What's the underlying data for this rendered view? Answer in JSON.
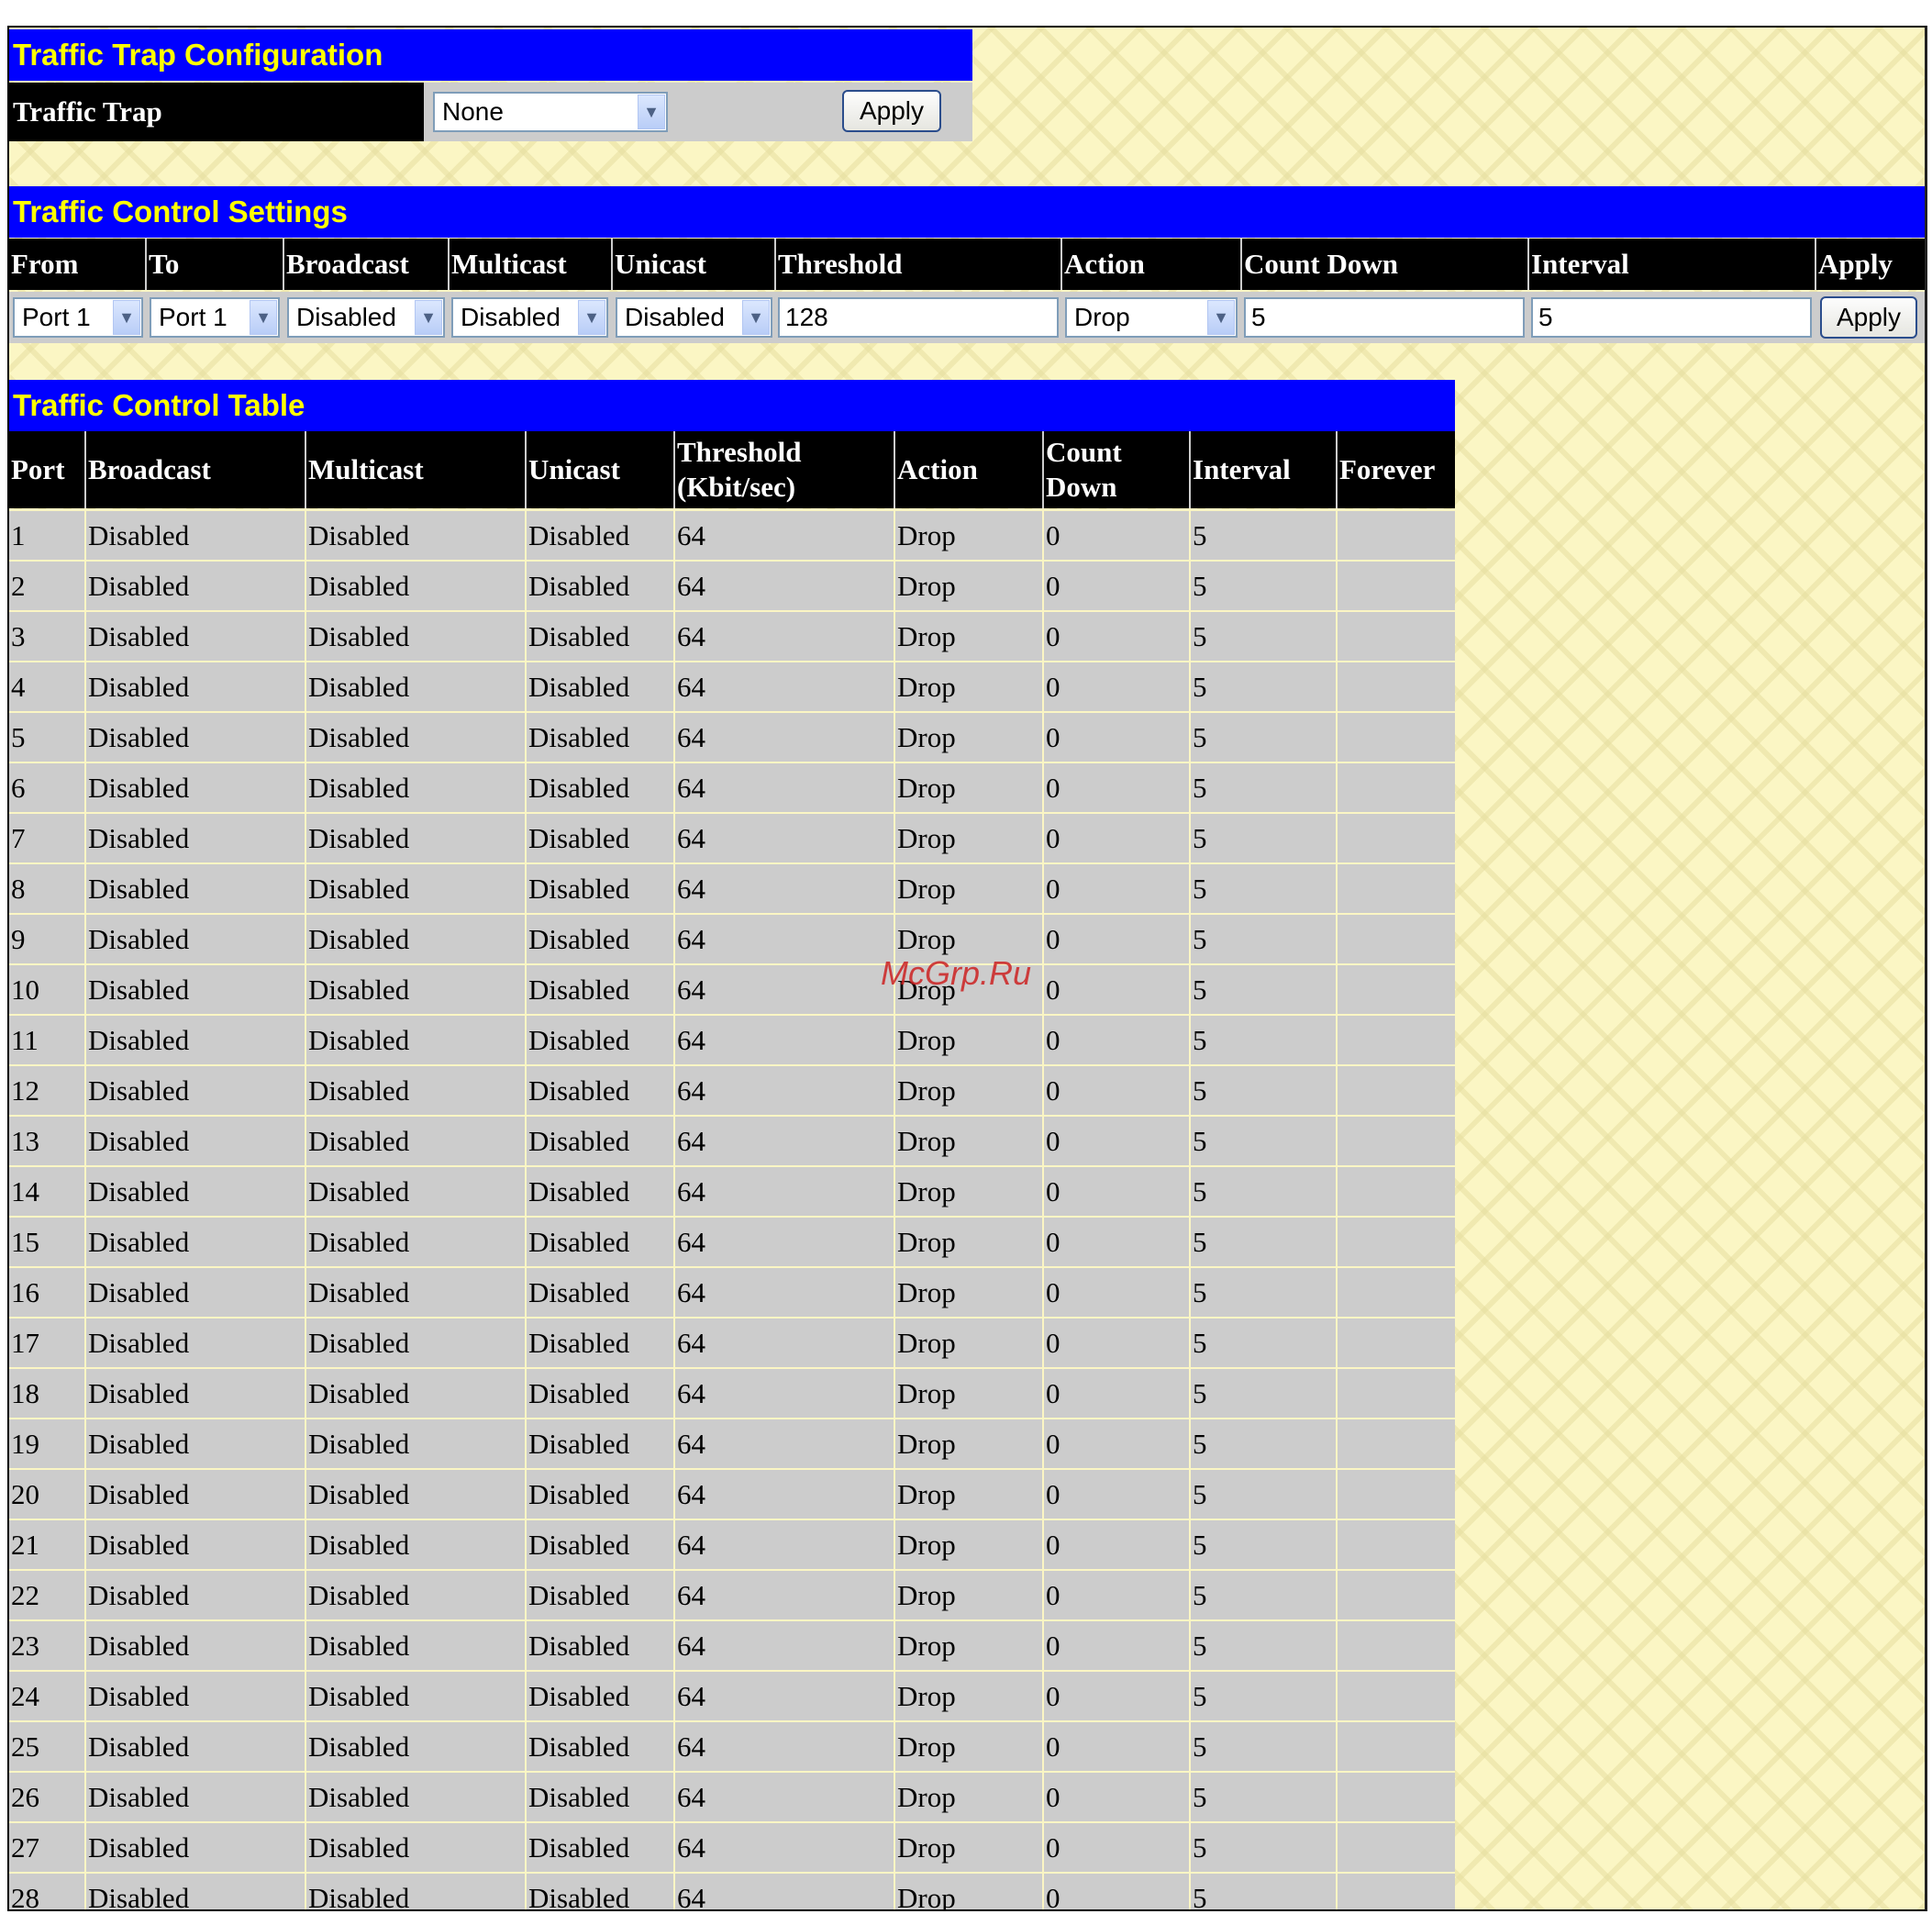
{
  "trap_config": {
    "title": "Traffic Trap Configuration",
    "label": "Traffic Trap",
    "selected": "None",
    "apply_label": "Apply"
  },
  "settings": {
    "title": "Traffic Control Settings",
    "headers": [
      "From",
      "To",
      "Broadcast",
      "Multicast",
      "Unicast",
      "Threshold",
      "Action",
      "Count Down",
      "Interval",
      "Apply"
    ],
    "from": "Port 1",
    "to": "Port 1",
    "broadcast": "Disabled",
    "multicast": "Disabled",
    "unicast": "Disabled",
    "threshold": "128",
    "action": "Drop",
    "count_down": "5",
    "interval": "5",
    "apply_label": "Apply"
  },
  "table": {
    "title": "Traffic Control Table",
    "headers": [
      "Port",
      "Broadcast",
      "Multicast",
      "Unicast",
      "Threshold (Kbit/sec)",
      "Action",
      "Count Down",
      "Interval",
      "Forever"
    ],
    "rows": [
      [
        "1",
        "Disabled",
        "Disabled",
        "Disabled",
        "64",
        "Drop",
        "0",
        "5",
        ""
      ],
      [
        "2",
        "Disabled",
        "Disabled",
        "Disabled",
        "64",
        "Drop",
        "0",
        "5",
        ""
      ],
      [
        "3",
        "Disabled",
        "Disabled",
        "Disabled",
        "64",
        "Drop",
        "0",
        "5",
        ""
      ],
      [
        "4",
        "Disabled",
        "Disabled",
        "Disabled",
        "64",
        "Drop",
        "0",
        "5",
        ""
      ],
      [
        "5",
        "Disabled",
        "Disabled",
        "Disabled",
        "64",
        "Drop",
        "0",
        "5",
        ""
      ],
      [
        "6",
        "Disabled",
        "Disabled",
        "Disabled",
        "64",
        "Drop",
        "0",
        "5",
        ""
      ],
      [
        "7",
        "Disabled",
        "Disabled",
        "Disabled",
        "64",
        "Drop",
        "0",
        "5",
        ""
      ],
      [
        "8",
        "Disabled",
        "Disabled",
        "Disabled",
        "64",
        "Drop",
        "0",
        "5",
        ""
      ],
      [
        "9",
        "Disabled",
        "Disabled",
        "Disabled",
        "64",
        "Drop",
        "0",
        "5",
        ""
      ],
      [
        "10",
        "Disabled",
        "Disabled",
        "Disabled",
        "64",
        "Drop",
        "0",
        "5",
        ""
      ],
      [
        "11",
        "Disabled",
        "Disabled",
        "Disabled",
        "64",
        "Drop",
        "0",
        "5",
        ""
      ],
      [
        "12",
        "Disabled",
        "Disabled",
        "Disabled",
        "64",
        "Drop",
        "0",
        "5",
        ""
      ],
      [
        "13",
        "Disabled",
        "Disabled",
        "Disabled",
        "64",
        "Drop",
        "0",
        "5",
        ""
      ],
      [
        "14",
        "Disabled",
        "Disabled",
        "Disabled",
        "64",
        "Drop",
        "0",
        "5",
        ""
      ],
      [
        "15",
        "Disabled",
        "Disabled",
        "Disabled",
        "64",
        "Drop",
        "0",
        "5",
        ""
      ],
      [
        "16",
        "Disabled",
        "Disabled",
        "Disabled",
        "64",
        "Drop",
        "0",
        "5",
        ""
      ],
      [
        "17",
        "Disabled",
        "Disabled",
        "Disabled",
        "64",
        "Drop",
        "0",
        "5",
        ""
      ],
      [
        "18",
        "Disabled",
        "Disabled",
        "Disabled",
        "64",
        "Drop",
        "0",
        "5",
        ""
      ],
      [
        "19",
        "Disabled",
        "Disabled",
        "Disabled",
        "64",
        "Drop",
        "0",
        "5",
        ""
      ],
      [
        "20",
        "Disabled",
        "Disabled",
        "Disabled",
        "64",
        "Drop",
        "0",
        "5",
        ""
      ],
      [
        "21",
        "Disabled",
        "Disabled",
        "Disabled",
        "64",
        "Drop",
        "0",
        "5",
        ""
      ],
      [
        "22",
        "Disabled",
        "Disabled",
        "Disabled",
        "64",
        "Drop",
        "0",
        "5",
        ""
      ],
      [
        "23",
        "Disabled",
        "Disabled",
        "Disabled",
        "64",
        "Drop",
        "0",
        "5",
        ""
      ],
      [
        "24",
        "Disabled",
        "Disabled",
        "Disabled",
        "64",
        "Drop",
        "0",
        "5",
        ""
      ],
      [
        "25",
        "Disabled",
        "Disabled",
        "Disabled",
        "64",
        "Drop",
        "0",
        "5",
        ""
      ],
      [
        "26",
        "Disabled",
        "Disabled",
        "Disabled",
        "64",
        "Drop",
        "0",
        "5",
        ""
      ],
      [
        "27",
        "Disabled",
        "Disabled",
        "Disabled",
        "64",
        "Drop",
        "0",
        "5",
        ""
      ],
      [
        "28",
        "Disabled",
        "Disabled",
        "Disabled",
        "64",
        "Drop",
        "0",
        "5",
        ""
      ]
    ]
  },
  "watermark": "McGrp.Ru",
  "colors": {
    "title_bar": "#0000ff",
    "title_text": "#ffff00",
    "header_bg": "#000000",
    "row_bg": "#cccccc",
    "page_bg": "#fbf6c4"
  }
}
